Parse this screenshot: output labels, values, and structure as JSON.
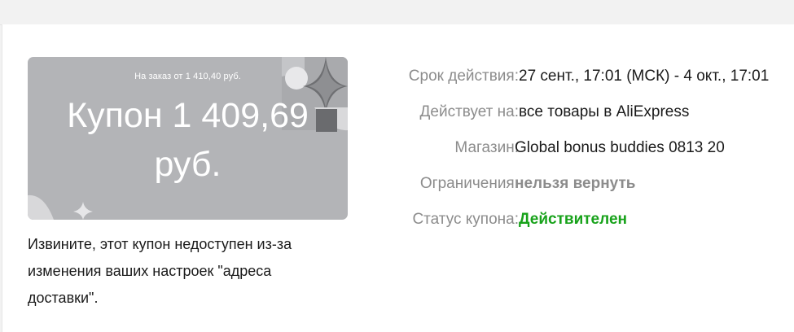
{
  "coupon": {
    "min_order": "На заказ от 1 410,40 руб.",
    "amount_line1": "Купон 1 409,69",
    "amount_line2": "руб."
  },
  "notice": {
    "line1": "Извините, этот купон недоступен из-за",
    "line2": "изменения ваших настроек \"адреса",
    "line3": "доставки\"."
  },
  "details": [
    {
      "label": "Срок действия:",
      "value": "27 сент., 17:01 (МСК) - 4 окт., 17:01"
    },
    {
      "label": "Действует на:",
      "value": "все товары в AliExpress"
    },
    {
      "label": "Магазин:",
      "value": "Global bonus buddies 0813 20"
    },
    {
      "label": "Ограничения:",
      "value": "нельзя вернуть"
    },
    {
      "label": "Статус купона:",
      "value": "Действителен"
    }
  ],
  "colors": {
    "card_bg": "#b3b4b7",
    "status_valid": "#17a21a",
    "label_gray": "#8c8c8c"
  }
}
